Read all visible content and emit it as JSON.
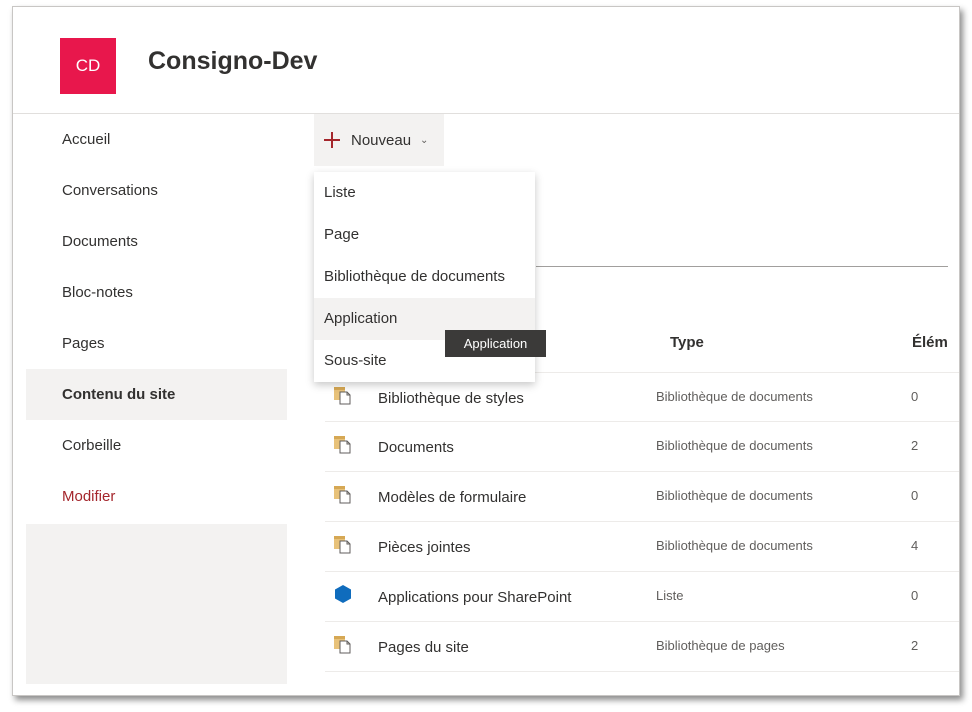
{
  "site": {
    "logo_initials": "CD",
    "logo_color": "#e8174c",
    "title": "Consigno-Dev"
  },
  "nav": {
    "items": [
      {
        "label": "Accueil",
        "name": "nav-item-accueil"
      },
      {
        "label": "Conversations",
        "name": "nav-item-conversations"
      },
      {
        "label": "Documents",
        "name": "nav-item-documents"
      },
      {
        "label": "Bloc-notes",
        "name": "nav-item-bloc-notes"
      },
      {
        "label": "Pages",
        "name": "nav-item-pages"
      },
      {
        "label": "Contenu du site",
        "name": "nav-item-contenu-du-site",
        "active": true
      },
      {
        "label": "Corbeille",
        "name": "nav-item-corbeille"
      }
    ],
    "edit_label": "Modifier"
  },
  "command_bar": {
    "new_label": "Nouveau",
    "new_icon": "plus-icon",
    "dropdown_icon": "chevron-down-icon"
  },
  "new_menu": {
    "items": [
      {
        "label": "Liste"
      },
      {
        "label": "Page"
      },
      {
        "label": "Bibliothèque de documents"
      },
      {
        "label": "Application",
        "hovered": true
      },
      {
        "label": "Sous-site"
      }
    ],
    "tooltip": "Application"
  },
  "table": {
    "columns": {
      "type": "Type",
      "items": "Élém"
    },
    "rows": [
      {
        "icon": "document-library-icon",
        "name": "Bibliothèque de styles",
        "type": "Bibliothèque de documents",
        "count": "0"
      },
      {
        "icon": "document-library-icon",
        "name": "Documents",
        "type": "Bibliothèque de documents",
        "count": "2"
      },
      {
        "icon": "document-library-icon",
        "name": "Modèles de formulaire",
        "type": "Bibliothèque de documents",
        "count": "0"
      },
      {
        "icon": "document-library-icon",
        "name": "Pièces jointes",
        "type": "Bibliothèque de documents",
        "count": "4"
      },
      {
        "icon": "app-hexagon-icon",
        "name": "Applications pour SharePoint",
        "type": "Liste",
        "count": "0"
      },
      {
        "icon": "document-library-icon",
        "name": "Pages du site",
        "type": "Bibliothèque de pages",
        "count": "2"
      }
    ]
  },
  "colors": {
    "accent_red": "#a4262c",
    "folder_icon": "#d6a854",
    "app_icon": "#0f6cbd"
  }
}
